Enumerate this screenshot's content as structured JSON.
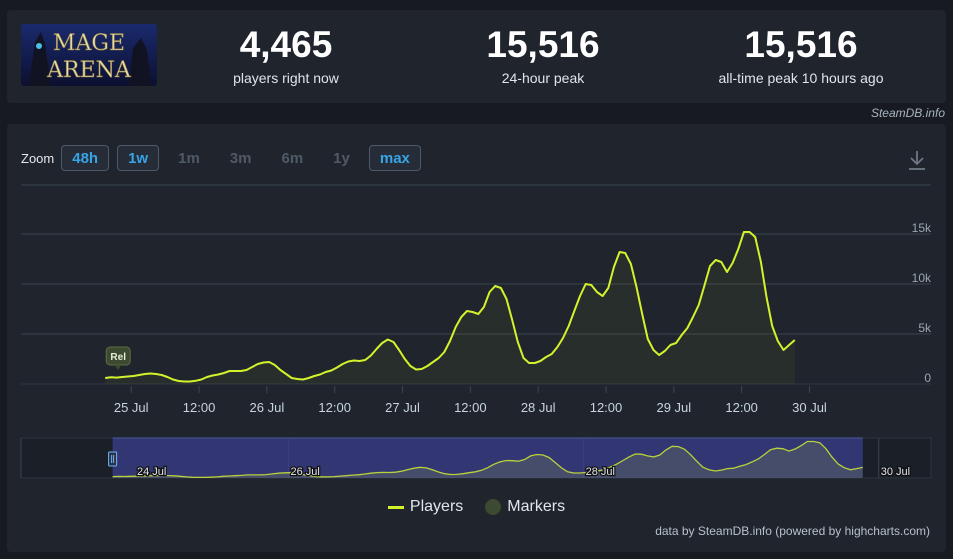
{
  "game": {
    "logo_text_line1": "MAGE",
    "logo_text_line2": "ARENA"
  },
  "stats": [
    {
      "value": "4,465",
      "label": "players right now"
    },
    {
      "value": "15,516",
      "label": "24-hour peak"
    },
    {
      "value": "15,516",
      "label": "all-time peak 10 hours ago"
    }
  ],
  "credit_top": "SteamDB.info",
  "zoom": {
    "label": "Zoom",
    "buttons": [
      {
        "label": "48h",
        "active": true
      },
      {
        "label": "1w",
        "active": true
      },
      {
        "label": "1m",
        "active": false
      },
      {
        "label": "3m",
        "active": false
      },
      {
        "label": "6m",
        "active": false
      },
      {
        "label": "1y",
        "active": false
      },
      {
        "label": "max",
        "active": true
      }
    ]
  },
  "marker_badge": "Rel",
  "legend": {
    "players": "Players",
    "markers": "Markers"
  },
  "credit_bottom": "data by SteamDB.info (powered by highcharts.com)",
  "colors": {
    "line": "#d3f22b",
    "navigator_mask": "#3b3f8c",
    "grid": "#3a4350"
  },
  "chart_data": {
    "type": "line",
    "x_unit": "hours since 25 Jul 00:00",
    "xlim": [
      -19.5,
      141.5
    ],
    "ylim": [
      0,
      15000
    ],
    "yticks": [
      {
        "v": 0,
        "label": "0"
      },
      {
        "v": 5000,
        "label": "5k"
      },
      {
        "v": 10000,
        "label": "10k"
      },
      {
        "v": 15000,
        "label": "15k"
      }
    ],
    "xticks": [
      {
        "h": 0,
        "label": "25 Jul"
      },
      {
        "h": 12,
        "label": "12:00"
      },
      {
        "h": 24,
        "label": "26 Jul"
      },
      {
        "h": 36,
        "label": "12:00"
      },
      {
        "h": 48,
        "label": "27 Jul"
      },
      {
        "h": 60,
        "label": "12:00"
      },
      {
        "h": 72,
        "label": "28 Jul"
      },
      {
        "h": 84,
        "label": "12:00"
      },
      {
        "h": 96,
        "label": "29 Jul"
      },
      {
        "h": 108,
        "label": "12:00"
      },
      {
        "h": 120,
        "label": "30 Jul"
      }
    ],
    "series": [
      {
        "name": "Players",
        "points": [
          [
            -4.6,
            600
          ],
          [
            -3.6,
            680
          ],
          [
            -2.6,
            640
          ],
          [
            -1.6,
            700
          ],
          [
            -0.6,
            750
          ],
          [
            0.4,
            800
          ],
          [
            1.4,
            900
          ],
          [
            2.4,
            1000
          ],
          [
            3.4,
            1050
          ],
          [
            4.4,
            1000
          ],
          [
            5.4,
            900
          ],
          [
            6.4,
            700
          ],
          [
            7.4,
            450
          ],
          [
            8.4,
            300
          ],
          [
            9.4,
            250
          ],
          [
            10.4,
            250
          ],
          [
            11.4,
            320
          ],
          [
            12.4,
            450
          ],
          [
            13.4,
            700
          ],
          [
            14.4,
            850
          ],
          [
            15.4,
            950
          ],
          [
            16.4,
            1100
          ],
          [
            17.4,
            1300
          ],
          [
            18.4,
            1300
          ],
          [
            19.4,
            1300
          ],
          [
            20.4,
            1400
          ],
          [
            21.4,
            1700
          ],
          [
            22.4,
            2000
          ],
          [
            23.4,
            2150
          ],
          [
            24.4,
            2200
          ],
          [
            25.4,
            1900
          ],
          [
            26.4,
            1400
          ],
          [
            27.4,
            1000
          ],
          [
            28.4,
            600
          ],
          [
            29.4,
            500
          ],
          [
            30.4,
            450
          ],
          [
            31.4,
            600
          ],
          [
            32.4,
            800
          ],
          [
            33.4,
            950
          ],
          [
            34.4,
            1200
          ],
          [
            35.4,
            1350
          ],
          [
            36.4,
            1650
          ],
          [
            37.4,
            2000
          ],
          [
            38.4,
            2250
          ],
          [
            39.4,
            2350
          ],
          [
            40.4,
            2300
          ],
          [
            41.4,
            2400
          ],
          [
            42.4,
            2850
          ],
          [
            43.4,
            3500
          ],
          [
            44.4,
            4100
          ],
          [
            45.4,
            4450
          ],
          [
            46.4,
            4200
          ],
          [
            47.4,
            3400
          ],
          [
            48.4,
            2500
          ],
          [
            49.4,
            1800
          ],
          [
            50.4,
            1450
          ],
          [
            51.4,
            1500
          ],
          [
            52.4,
            1800
          ],
          [
            53.4,
            2200
          ],
          [
            54.4,
            2600
          ],
          [
            55.4,
            3200
          ],
          [
            56.4,
            4300
          ],
          [
            57.4,
            5700
          ],
          [
            58.4,
            6700
          ],
          [
            59.4,
            7300
          ],
          [
            60.4,
            7200
          ],
          [
            61.4,
            7000
          ],
          [
            62.4,
            7700
          ],
          [
            63.4,
            9200
          ],
          [
            64.4,
            9800
          ],
          [
            65.4,
            9600
          ],
          [
            66.4,
            8500
          ],
          [
            67.4,
            6400
          ],
          [
            68.4,
            4200
          ],
          [
            69.4,
            2600
          ],
          [
            70.4,
            2100
          ],
          [
            71.4,
            2100
          ],
          [
            72.4,
            2300
          ],
          [
            73.4,
            2700
          ],
          [
            74.4,
            3000
          ],
          [
            75.4,
            3700
          ],
          [
            76.4,
            4600
          ],
          [
            77.4,
            5800
          ],
          [
            78.4,
            7300
          ],
          [
            79.4,
            8800
          ],
          [
            80.4,
            10000
          ],
          [
            81.4,
            9900
          ],
          [
            82.4,
            9200
          ],
          [
            83.4,
            8800
          ],
          [
            84.4,
            9600
          ],
          [
            85.4,
            11700
          ],
          [
            86.4,
            13200
          ],
          [
            87.4,
            13100
          ],
          [
            88.4,
            12000
          ],
          [
            89.4,
            9700
          ],
          [
            90.4,
            7000
          ],
          [
            91.4,
            4500
          ],
          [
            92.4,
            3400
          ],
          [
            93.4,
            2900
          ],
          [
            94.4,
            3300
          ],
          [
            95.4,
            3900
          ],
          [
            96.4,
            4100
          ],
          [
            97.4,
            4900
          ],
          [
            98.4,
            5600
          ],
          [
            99.4,
            6700
          ],
          [
            100.4,
            7900
          ],
          [
            101.4,
            9800
          ],
          [
            102.4,
            11800
          ],
          [
            103.4,
            12400
          ],
          [
            104.4,
            12200
          ],
          [
            105.4,
            11200
          ],
          [
            106.4,
            12100
          ],
          [
            107.4,
            13500
          ],
          [
            108.4,
            15200
          ],
          [
            109.4,
            15200
          ],
          [
            110.4,
            14700
          ],
          [
            111.4,
            12200
          ],
          [
            112.4,
            8700
          ],
          [
            113.4,
            5800
          ],
          [
            114.4,
            4300
          ],
          [
            115.4,
            3400
          ],
          [
            116.4,
            3900
          ],
          [
            117.4,
            4400
          ]
        ]
      }
    ],
    "navigator": {
      "xlim": [
        -19.5,
        128.5
      ],
      "selected": [
        -4.6,
        117.4
      ],
      "labels": [
        {
          "h": -24,
          "label": "24 Jul"
        },
        {
          "h": 24,
          "label": "26 Jul"
        },
        {
          "h": 72,
          "label": "28 Jul"
        },
        {
          "h": 120,
          "label": "30 Jul"
        }
      ]
    }
  }
}
